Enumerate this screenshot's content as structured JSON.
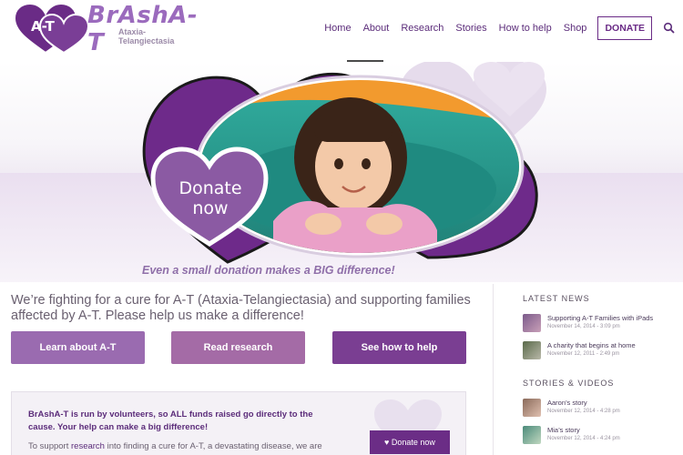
{
  "brand": {
    "name": "BrAshA-T",
    "subtitle": "Ataxia-Telangiectasia",
    "heart_text": "A-T",
    "colors": {
      "primary": "#6a2b86",
      "light": "#9b6bbd"
    }
  },
  "nav": {
    "items": [
      "Home",
      "About",
      "Research",
      "Stories",
      "How to help",
      "Shop"
    ],
    "donate": "DONATE",
    "search_icon": "search-icon"
  },
  "hero": {
    "donate_bubble": {
      "line1": "Donate",
      "line2": "now"
    },
    "tagline": "Even a small donation makes a BIG difference!"
  },
  "main": {
    "intro": "We’re fighting for a cure for A-T (Ataxia-Telangiectasia) and supporting families affected by A-T. Please help us make a difference!",
    "buttons": [
      "Learn about A-T",
      "Read research",
      "See how to help"
    ],
    "volunteer": {
      "text": "BrAshA-T is run by volunteers, so ALL funds raised go directly to the cause. Your help can make a big difference!",
      "text2_pre": "To support ",
      "text2_link": "research",
      "text2_post": " into finding a cure for A-T, a devastating disease, we are",
      "donate_button": "♥ Donate now"
    }
  },
  "sidebar": {
    "latest_news_heading": "LATEST NEWS",
    "news": [
      {
        "title": "Supporting A-T Families with iPads",
        "date": "November 14, 2014 - 3:09 pm"
      },
      {
        "title": "A charity that begins at home",
        "date": "November 12, 2011 - 2:49 pm"
      }
    ],
    "stories_heading": "STORIES & VIDEOS",
    "stories": [
      {
        "title": "Aaron’s story",
        "date": "November 12, 2014 - 4:28 pm"
      },
      {
        "title": "Mia’s story",
        "date": "November 12, 2014 - 4:24 pm"
      }
    ]
  }
}
